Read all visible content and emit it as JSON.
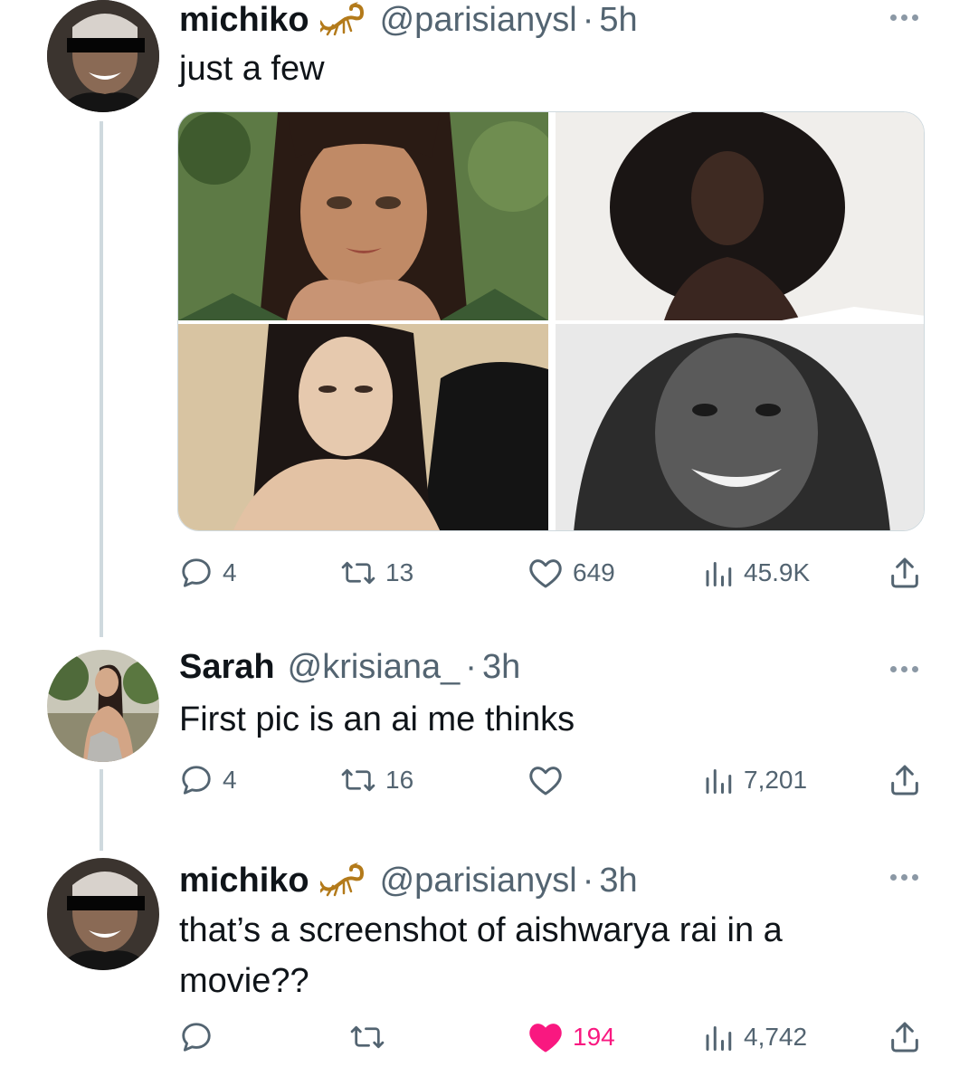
{
  "tweets": [
    {
      "name": "michiko",
      "handle": "@parisianysl",
      "separator": "·",
      "time": "5h",
      "text": "just a few",
      "has_scorpion": true,
      "media": [
        {
          "description": "woman with dark hair, hands folded under chin"
        },
        {
          "description": "woman with large natural hair"
        },
        {
          "description": "woman with long dark hair"
        },
        {
          "description": "black and white smiling woman"
        }
      ],
      "actions": {
        "replies": "4",
        "reposts": "13",
        "likes": "649",
        "views": "45.9K"
      }
    },
    {
      "name": "Sarah",
      "handle": "@krisiana_",
      "separator": "·",
      "time": "3h",
      "text": "First pic is an ai me thinks",
      "actions": {
        "replies": "4",
        "reposts": "16",
        "likes": "",
        "views": "7,201"
      }
    },
    {
      "name": "michiko",
      "handle": "@parisianysl",
      "separator": "·",
      "time": "3h",
      "text": "that’s a screenshot of aishwarya rai in a movie??",
      "has_scorpion": true,
      "actions": {
        "replies": "",
        "reposts": "",
        "likes": "194",
        "views": "4,742",
        "liked": true
      }
    }
  ],
  "colors": {
    "text": "#0f1419",
    "secondary": "#536471",
    "like": "#f91880",
    "thread": "#cfd9de"
  }
}
